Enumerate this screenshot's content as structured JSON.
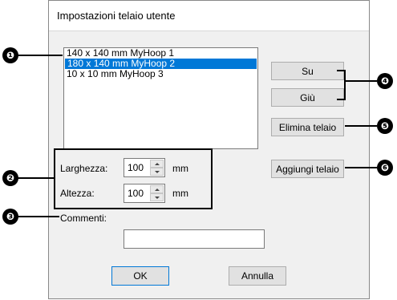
{
  "dialog": {
    "title": "Impostazioni telaio utente",
    "hoop_list": [
      {
        "label": "140 x 140 mm MyHoop 1",
        "selected": false
      },
      {
        "label": "180 x 140 mm MyHoop 2",
        "selected": true
      },
      {
        "label": "10 x 10 mm MyHoop 3",
        "selected": false
      }
    ],
    "buttons": {
      "up": "Su",
      "down": "Giù",
      "delete": "Elimina telaio",
      "add": "Aggiungi telaio",
      "ok": "OK",
      "cancel": "Annulla"
    },
    "size": {
      "width_label": "Larghezza:",
      "width_value": "100",
      "height_label": "Altezza:",
      "height_value": "100",
      "unit": "mm"
    },
    "comments": {
      "label": "Commenti:",
      "value": ""
    }
  },
  "callouts": [
    "❶",
    "❷",
    "❸",
    "❹",
    "❺",
    "❻"
  ],
  "colors": {
    "selection": "#0078d7",
    "dialog_bg": "#f0f0f0",
    "callout": "#000000"
  }
}
